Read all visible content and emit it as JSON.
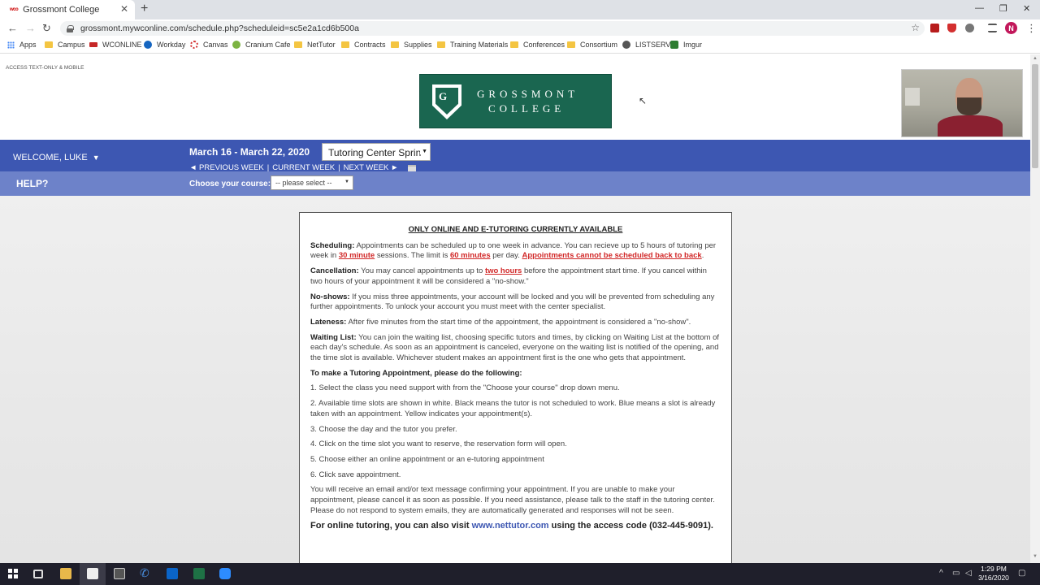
{
  "browser": {
    "tab_title": "Grossmont College",
    "tab_favicon_text": "wco",
    "url": "grossmont.mywconline.com/schedule.php?scheduleid=sc5e2a1cd6b500a",
    "profile_initial": "N",
    "bookmarks": [
      "Apps",
      "Campus",
      "WCONLINE",
      "Workday",
      "Canvas",
      "Cranium Cafe",
      "NetTutor",
      "Contracts",
      "Supplies",
      "Training Materials",
      "Conferences",
      "Consortium",
      "LISTSERV",
      "Imgur"
    ]
  },
  "header": {
    "access_link": "ACCESS TEXT-ONLY & MOBILE",
    "logo_line1": "GROSSMONT",
    "logo_line2": "COLLEGE",
    "logo_shield": "G"
  },
  "schedule_bar": {
    "welcome": "WELCOME, LUKE",
    "week_range": "March 16 - March 22, 2020",
    "schedule_select": "Tutoring Center Sprin",
    "prev_week": "◄ PREVIOUS WEEK",
    "current_week": "CURRENT WEEK",
    "next_week": "NEXT WEEK ►",
    "separator": "|"
  },
  "course_bar": {
    "help": "HELP?",
    "course_label": "Choose your course:",
    "course_select": "-- please select --"
  },
  "notice": {
    "title": "ONLY ONLINE AND E-TUTORING CURRENTLY AVAILABLE",
    "scheduling_label": "Scheduling:",
    "scheduling_text1": " Appointments can be scheduled up to one week in advance. You can recieve up to 5 hours of tutoring per week in ",
    "scheduling_30": "30 minute",
    "scheduling_text2": " sessions. The limit is ",
    "scheduling_60": "60 minutes",
    "scheduling_text3": " per day. ",
    "scheduling_backtoback": "Appointments cannot be scheduled back to back",
    "scheduling_end": ".",
    "cancellation_label": "Cancellation:",
    "cancellation_text1": " You may cancel appointments up to ",
    "cancellation_two": "two hours",
    "cancellation_text2": " before the appointment start time. If you cancel within two hours of your appointment it will be considered a \"no-show.\"",
    "noshows_label": "No-shows:",
    "noshows_text": " If you miss three appointments, your account will be locked and you will be prevented from scheduling any further appointments. To unlock your account you must meet with the center specialist.",
    "lateness_label": "Lateness:",
    "lateness_text": " After five minutes from the start time of the appointment, the appointment is considered a \"no-show\".",
    "waiting_label": "Waiting List:",
    "waiting_text": " You can join the waiting list, choosing specific tutors and times, by clicking on Waiting List at the bottom of each day's schedule. As soon as an appointment is canceled, everyone on the waiting list is notified of the opening, and the time slot is available. Whichever student makes an appointment first is the one who gets that appointment.",
    "howto_title": "To make a Tutoring Appointment, please do the following:",
    "steps": [
      "1. Select the class you need support with from the \"Choose your course\" drop down menu.",
      "2. Available time slots are shown in white. Black means the tutor is not scheduled to work. Blue means a slot is already taken with an appointment. Yellow indicates your appointment(s).",
      "3. Choose the day and the tutor you prefer.",
      "4. Click on the time slot you want to reserve, the reservation form will open.",
      "5. Choose either an online appointment or an e-tutoring appointment",
      "6. Click save appointment."
    ],
    "confirm_text": "You will receive an email and/or text message confirming your appointment. If you are unable to make your appointment, please cancel it as soon as possible. If you need assistance, please talk to the staff in the tutoring center. Please do not respond to system emails, they are automatically generated and responses will not be seen.",
    "online_text1": "For online tutoring, you can also visit ",
    "online_link": "www.nettutor.com",
    "online_text2": " using the access code (032-445-9091)."
  },
  "taskbar": {
    "time": "1:29 PM",
    "date": "3/16/2020"
  },
  "colors": {
    "primary_bar": "#3d57b2",
    "secondary_bar": "#6d82c9",
    "logo_green": "#1a6650",
    "emphasis_red": "#d12828"
  }
}
